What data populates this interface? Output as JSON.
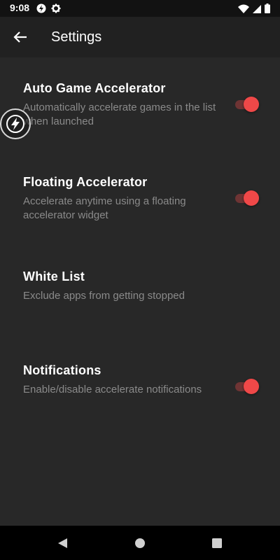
{
  "status_bar": {
    "time": "9:08",
    "icons_left": [
      "vpn-icon",
      "gear-icon"
    ],
    "icons_right": [
      "wifi-icon",
      "signal-icon",
      "battery-icon"
    ]
  },
  "app_bar": {
    "back_icon": "arrow-back-icon",
    "title": "Settings"
  },
  "settings": [
    {
      "title": "Auto Game Accelerator",
      "summary": "Automatically accelerate games in the list when launched",
      "toggle": true,
      "enabled": true
    },
    {
      "title": "Floating Accelerator",
      "summary": "Accelerate anytime using a floating accelerator widget",
      "toggle": true,
      "enabled": true
    },
    {
      "title": "White List",
      "summary": "Exclude apps from getting stopped",
      "toggle": false
    },
    {
      "title": "Notifications",
      "summary": "Enable/disable accelerate notifications",
      "toggle": true,
      "enabled": true
    }
  ],
  "floating_widget": {
    "icon": "lightning-bolt-icon"
  },
  "nav_bar": {
    "icons": [
      "back-triangle-icon",
      "home-circle-icon",
      "recents-square-icon"
    ]
  },
  "colors": {
    "accent": "#ef4848",
    "track": "#6e3434",
    "background": "#282828",
    "app_bar": "#212121",
    "summary_text": "#8a8a8a"
  }
}
